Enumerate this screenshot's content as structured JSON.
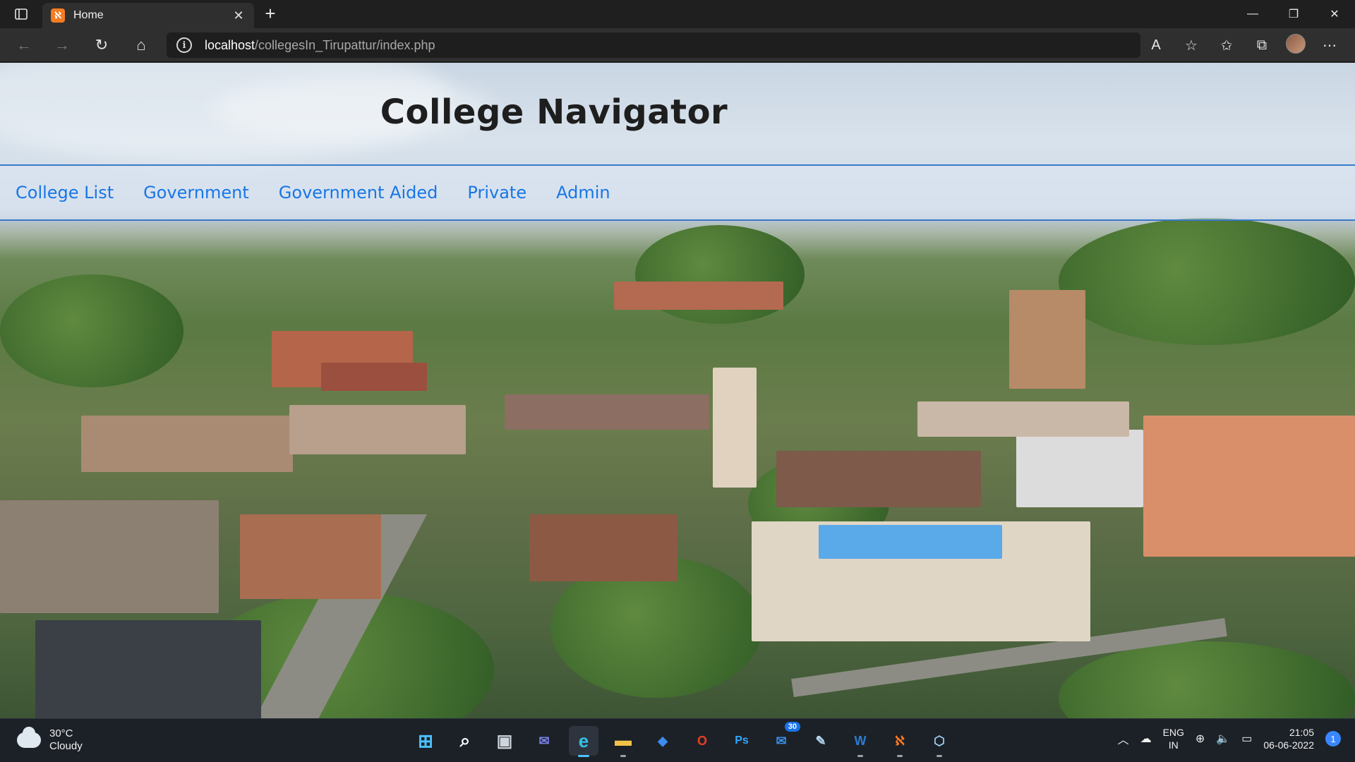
{
  "browser": {
    "tab_title": "Home",
    "tab_favicon": "xampp-icon",
    "close_tab": "✕",
    "new_tab": "+",
    "url_host": "localhost",
    "url_path": "/collegesIn_Tirupattur/index.php",
    "info_glyph": "i"
  },
  "site": {
    "title": "College Navigator",
    "nav": [
      {
        "label": "College List"
      },
      {
        "label": "Government"
      },
      {
        "label": "Government Aided"
      },
      {
        "label": "Private"
      },
      {
        "label": "Admin"
      }
    ]
  },
  "taskbar": {
    "weather": {
      "temp": "30°C",
      "condition": "Cloudy"
    },
    "apps": [
      {
        "name": "start",
        "glyph": "⊞"
      },
      {
        "name": "search",
        "glyph": "⌕"
      },
      {
        "name": "task-view",
        "glyph": "▣"
      },
      {
        "name": "chat",
        "glyph": "✉"
      },
      {
        "name": "edge",
        "glyph": "e"
      },
      {
        "name": "file-explorer",
        "glyph": "▬"
      },
      {
        "name": "dropbox",
        "glyph": "◆"
      },
      {
        "name": "office",
        "glyph": "O"
      },
      {
        "name": "photoshop",
        "glyph": "Ps"
      },
      {
        "name": "notifications-app",
        "glyph": "✉",
        "badge": "30"
      },
      {
        "name": "notepad",
        "glyph": "✎"
      },
      {
        "name": "word",
        "glyph": "W"
      },
      {
        "name": "xampp",
        "glyph": "ℵ"
      },
      {
        "name": "virtualbox",
        "glyph": "⬡"
      }
    ],
    "lang_top": "ENG",
    "lang_bottom": "IN",
    "time": "21:05",
    "date": "06-06-2022",
    "notification_count": "1"
  },
  "colors": {
    "link": "#1976e6",
    "rule": "#3a79c9",
    "title": "#1e1e1e"
  }
}
